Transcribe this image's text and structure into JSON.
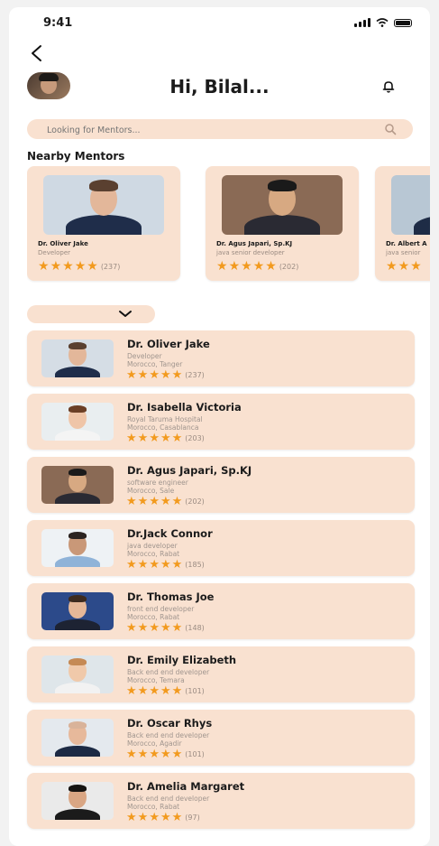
{
  "status_bar": {
    "time": "9:41"
  },
  "header": {
    "greeting": "Hi, Bilal..."
  },
  "search": {
    "placeholder": "Looking for Mentors..."
  },
  "nearby": {
    "title": "Nearby Mentors",
    "cards": [
      {
        "name": "Dr. Oliver Jake",
        "role": "Developer",
        "count": "(237)",
        "rating": 5,
        "bg": "#cfd9e3",
        "skin": "#e3b79a",
        "hair": "#5a4030",
        "suit": "#1f2d4a"
      },
      {
        "name": "Dr. Agus Japari, Sp.KJ",
        "role": "java senior developer",
        "count": "(202)",
        "rating": 5,
        "bg": "#8a6a55",
        "skin": "#d7a982",
        "hair": "#1a1a1a",
        "suit": "#2a2a33"
      },
      {
        "name": "Dr. Albert A",
        "role": "java senior",
        "count": "",
        "rating": 3,
        "bg": "#b8c7d4",
        "skin": "#e0b393",
        "hair": "#c79a7b",
        "suit": "#1e2c46"
      }
    ]
  },
  "list": {
    "items": [
      {
        "name": "Dr. Oliver Jake",
        "role": "Developer",
        "location": "Morocco, Tanger",
        "count": "(237)",
        "rating": 5,
        "bg": "#d5dde5",
        "skin": "#e3b79a",
        "hair": "#5a4030",
        "suit": "#1f2d4a"
      },
      {
        "name": "Dr. Isabella Victoria",
        "role": "Royal Taruma Hospital",
        "location": "Morocco, Casablanca",
        "count": "(203)",
        "rating": 5,
        "bg": "#e9eef0",
        "skin": "#efc5a8",
        "hair": "#6b3f26",
        "suit": "#f4f4f4"
      },
      {
        "name": "Dr. Agus Japari, Sp.KJ",
        "role": "software engineer",
        "location": "Morocco, Sale",
        "count": "(202)",
        "rating": 5,
        "bg": "#8a6a55",
        "skin": "#d7a982",
        "hair": "#1a1a1a",
        "suit": "#2a2a33"
      },
      {
        "name": "Dr.Jack Connor",
        "role": "java developer",
        "location": "Morocco, Rabat",
        "count": "(185)",
        "rating": 5,
        "bg": "#eef2f5",
        "skin": "#c99878",
        "hair": "#2b2421",
        "suit": "#8fb3d8"
      },
      {
        "name": "Dr. Thomas Joe",
        "role": "front end developer",
        "location": "Morocco, Rabat",
        "count": "(148)",
        "rating": 5,
        "bg": "#2c4a8a",
        "skin": "#e6b898",
        "hair": "#3d2b1f",
        "suit": "#1d2333"
      },
      {
        "name": "Dr. Emily Elizabeth",
        "role": "Back end end developer",
        "location": "Morocco, Temara",
        "count": "(101)",
        "rating": 5,
        "bg": "#dfe6ea",
        "skin": "#f0c9aa",
        "hair": "#c58a55",
        "suit": "#f2f2f2"
      },
      {
        "name": "Dr. Oscar Rhys",
        "role": "Back end end developer",
        "location": "Morocco, Agadir",
        "count": "(101)",
        "rating": 5,
        "bg": "#e4e9ee",
        "skin": "#e7b99b",
        "hair": "#d9b39a",
        "suit": "#1c2a44"
      },
      {
        "name": "Dr. Amelia Margaret",
        "role": "Back end end developer",
        "location": "Morocco, Rabat",
        "count": "(97)",
        "rating": 5,
        "bg": "#eaeaea",
        "skin": "#d9a684",
        "hair": "#161412",
        "suit": "#1b1b1b"
      }
    ]
  },
  "colors": {
    "card": "#f9e1d0",
    "star": "#f29a1e",
    "muted": "#a0958e"
  }
}
